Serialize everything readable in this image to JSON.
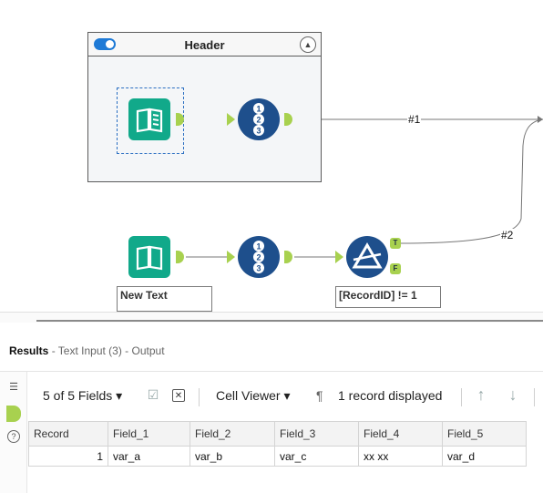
{
  "canvas": {
    "container": {
      "title": "Header"
    },
    "wire_labels": [
      "#1",
      "#2"
    ],
    "annotations": {
      "text_input": "New Text",
      "filter": "[RecordID] != 1"
    },
    "filter_anchors": {
      "true_label": "T",
      "false_label": "F"
    }
  },
  "results": {
    "title_bold": "Results",
    "title_rest": " - Text Input (3) - Output"
  },
  "toolbar": {
    "fields_selector": "5 of 5 Fields",
    "cell_viewer": "Cell Viewer",
    "pilcrow": "¶",
    "records_displayed": "1 record displayed",
    "dropdown_glyph": "▾"
  },
  "grid": {
    "columns": [
      "Record",
      "Field_1",
      "Field_2",
      "Field_3",
      "Field_4",
      "Field_5"
    ],
    "rows": [
      [
        "1",
        "var_a",
        "var_b",
        "var_c",
        "xx xx",
        "var_d"
      ]
    ]
  },
  "colors": {
    "tool_green": "#11a98a",
    "tool_blue": "#1e4f8c",
    "anchor_green": "#a8d14f",
    "toggle_blue": "#1e7ad6",
    "connection_purple": "#6a5acd"
  }
}
